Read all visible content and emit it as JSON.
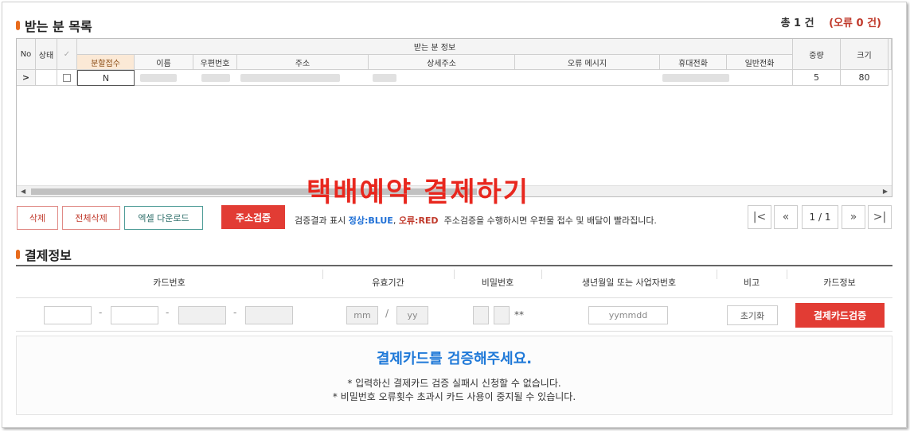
{
  "recipients": {
    "title": "받는 분 목록",
    "total": "총 1 건",
    "errors": "(오류 0 건)",
    "table": {
      "col_no": "No",
      "col_status": "상태",
      "col_check": "✓",
      "group_header": "받는 분 정보",
      "sub_headers": [
        "분할접수",
        "이름",
        "우편번호",
        "주소",
        "상세주소",
        "오류 메시지",
        "휴대전화",
        "일반전화"
      ],
      "col_weight": "중량",
      "col_size": "크기",
      "row": {
        "arrow": ">",
        "split": "N",
        "weight": "5",
        "size": "80"
      }
    }
  },
  "overlay": "택배예약 결제하기",
  "actions": {
    "delete": "삭제",
    "delete_all": "전체삭제",
    "excel_download": "엑셀 다운로드",
    "verify_address": "주소검증",
    "note_prefix": "검증결과 표시",
    "note_normal": "정상:BLUE",
    "note_sep": ",",
    "note_error": "오류:RED",
    "note_suffix": "주소검증을 수행하시면 우편물 접수 및 배달이 빨라집니다."
  },
  "pagination": {
    "first": "|<",
    "prev": "«",
    "info": "1 / 1",
    "next": "»",
    "last": ">|"
  },
  "payment": {
    "title": "결제정보",
    "headers": {
      "card_number": "카드번호",
      "expiry": "유효기간",
      "password": "비밀번호",
      "birth_or_biz": "생년월일 또는 사업자번호",
      "remark": "비고",
      "card_info": "카드정보"
    },
    "fields": {
      "expiry_mm": "mm",
      "expiry_sep": "/",
      "expiry_yy": "yy",
      "password_mask": "**",
      "birth_placeholder": "yymmdd",
      "card_sep": "-"
    },
    "reset_button": "초기화",
    "verify_card_button": "결제카드검증",
    "notice": {
      "heading": "결제카드를 검증해주세요.",
      "line1": "* 입력하신 결제카드 검증 실패시 신청할 수 없습니다.",
      "line2": "* 비밀번호 오류횟수 초과시 카드 사용이 중지될 수 있습니다."
    }
  }
}
